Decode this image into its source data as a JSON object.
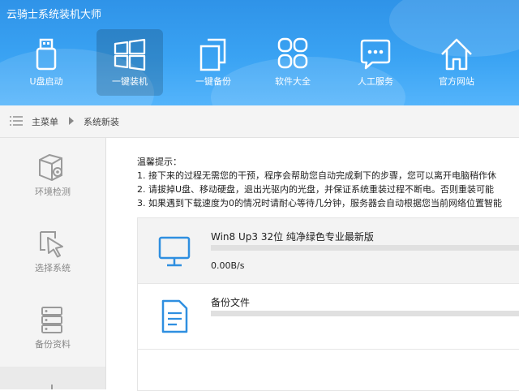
{
  "app": {
    "title": "云骑士系统装机大师"
  },
  "nav": [
    {
      "label": "U盘启动",
      "icon": "usb-drive-icon",
      "active": false
    },
    {
      "label": "一键装机",
      "icon": "windows-logo-icon",
      "active": true
    },
    {
      "label": "一键备份",
      "icon": "copy-backup-icon",
      "active": false
    },
    {
      "label": "软件大全",
      "icon": "apps-grid-icon",
      "active": false
    },
    {
      "label": "人工服务",
      "icon": "chat-bubble-icon",
      "active": false
    },
    {
      "label": "官方网站",
      "icon": "home-icon",
      "active": false
    }
  ],
  "breadcrumb": {
    "menu_label": "主菜单",
    "current": "系统新装"
  },
  "sidebar": [
    {
      "label": "环境检测",
      "icon": "settings-box-icon"
    },
    {
      "label": "选择系统",
      "icon": "cursor-select-icon"
    },
    {
      "label": "备份资料",
      "icon": "database-icon"
    }
  ],
  "tips": {
    "title": "温馨提示：",
    "lines": [
      "1. 接下来的过程无需您的干预，程序会帮助您自动完成剩下的步骤，您可以离开电脑稍作休",
      "2. 请拔掉U盘、移动硬盘，退出光驱内的光盘，并保证系统重装过程不断电。否则重装可能",
      "3. 如果遇到下载速度为0的情况时请耐心等待几分钟，服务器会自动根据您当前网络位置智能"
    ]
  },
  "tasks": [
    {
      "name": "Win8 Up3 32位 纯净绿色专业最新版",
      "speed": "0.00B/s",
      "progress": 0,
      "icon": "monitor-icon"
    },
    {
      "name": "备份文件",
      "speed": "",
      "progress": 0,
      "icon": "document-icon"
    }
  ],
  "colors": {
    "header": "#3aa3f3",
    "accent": "#2c9be9",
    "icon_blue": "#2f8fe0",
    "sidebar_icon": "#9a9a9a"
  }
}
